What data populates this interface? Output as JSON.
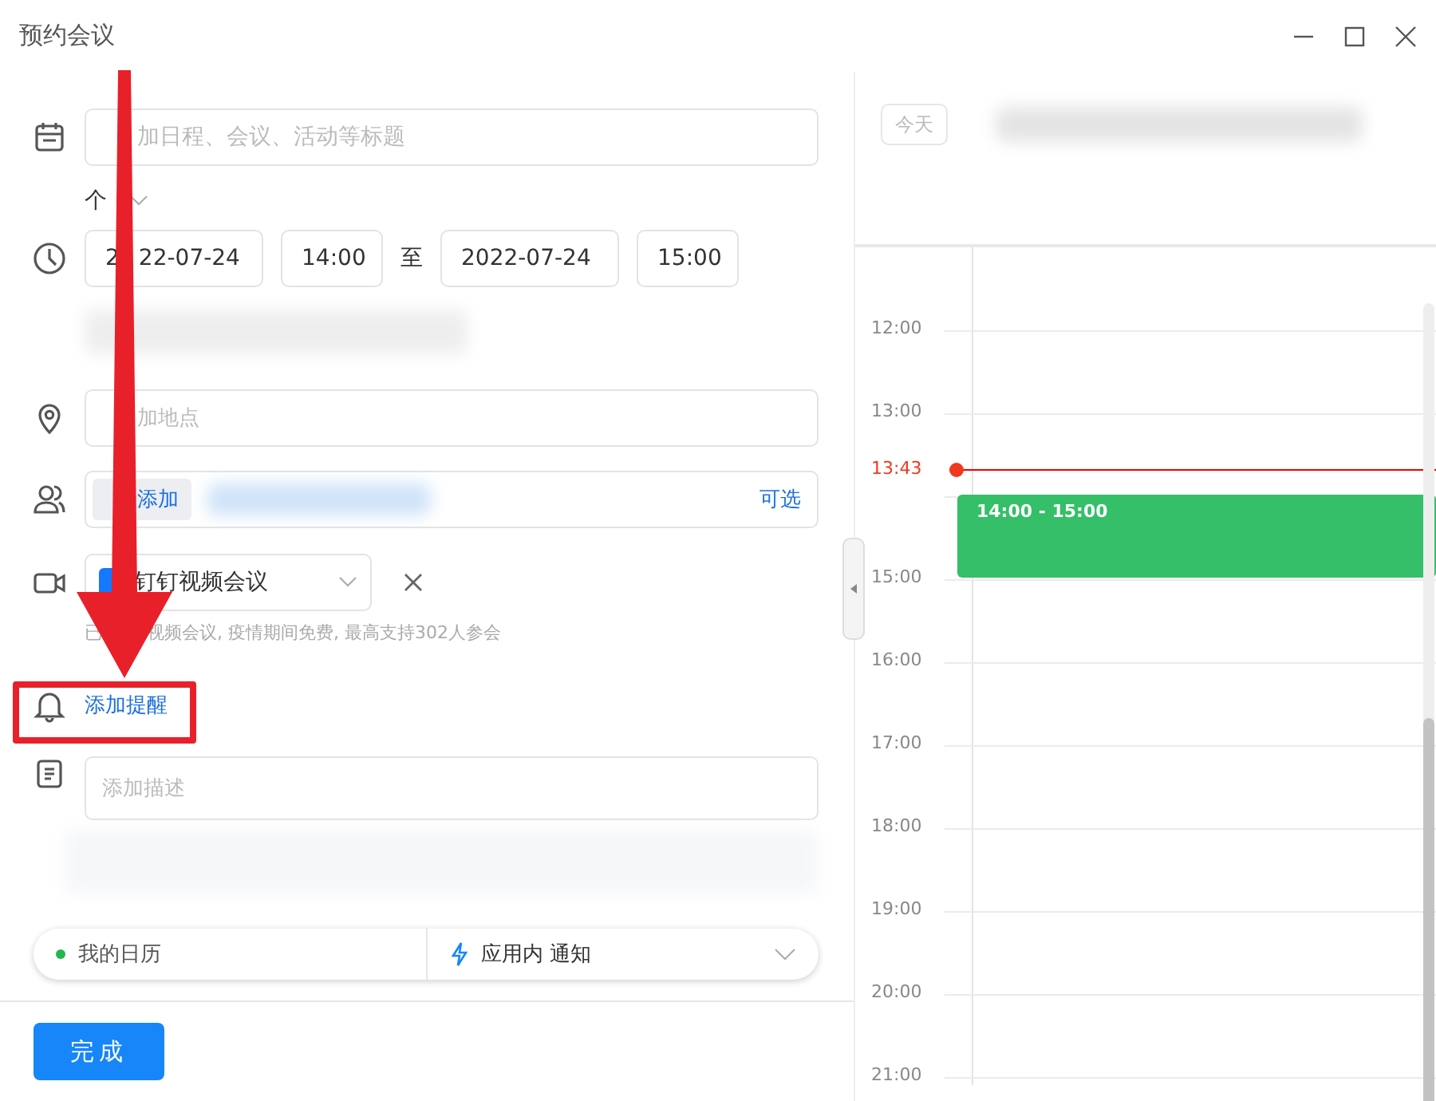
{
  "window": {
    "title": "预约会议"
  },
  "form": {
    "title_field": {
      "placeholder": "加日程、会议、活动等标题"
    },
    "calendar_type": "个",
    "time": {
      "start_date": [
        "2",
        "22-07-24"
      ],
      "start_time": "14:00",
      "separator": "至",
      "end_date": "2022-07-24",
      "end_time": "15:00"
    },
    "location": {
      "placeholder": "加地点"
    },
    "attendees": {
      "add_button": "添加",
      "optional": "可选"
    },
    "video": {
      "value": "钉钉视频会议",
      "note": [
        "已",
        "视频会议, 疫情期间免费, 最高支持302人参会"
      ]
    },
    "reminder": "添加提醒",
    "description": {
      "placeholder": "添加描述"
    },
    "footer": {
      "calendar": {
        "label": "我的日历",
        "color": "#1fb84c"
      },
      "notify": "应用内 通知"
    },
    "done_button": "完成"
  },
  "calendar": {
    "today_button": "今天",
    "slots": [
      {
        "kind": "hour"
      },
      {
        "kind": "hour",
        "label": "12:00"
      },
      {
        "kind": "hour",
        "label": "13:00"
      },
      {
        "kind": "now",
        "label": "13:43",
        "event": {
          "label": "14:00 - 15:00",
          "color": "#34bf68"
        }
      },
      {
        "kind": "hour",
        "label": "15:00"
      },
      {
        "kind": "hour",
        "label": "16:00"
      },
      {
        "kind": "hour",
        "label": "17:00"
      },
      {
        "kind": "hour",
        "label": "18:00"
      },
      {
        "kind": "hour",
        "label": "19:00"
      },
      {
        "kind": "hour",
        "label": "20:00"
      },
      {
        "kind": "hour",
        "label": "21:00"
      }
    ]
  }
}
